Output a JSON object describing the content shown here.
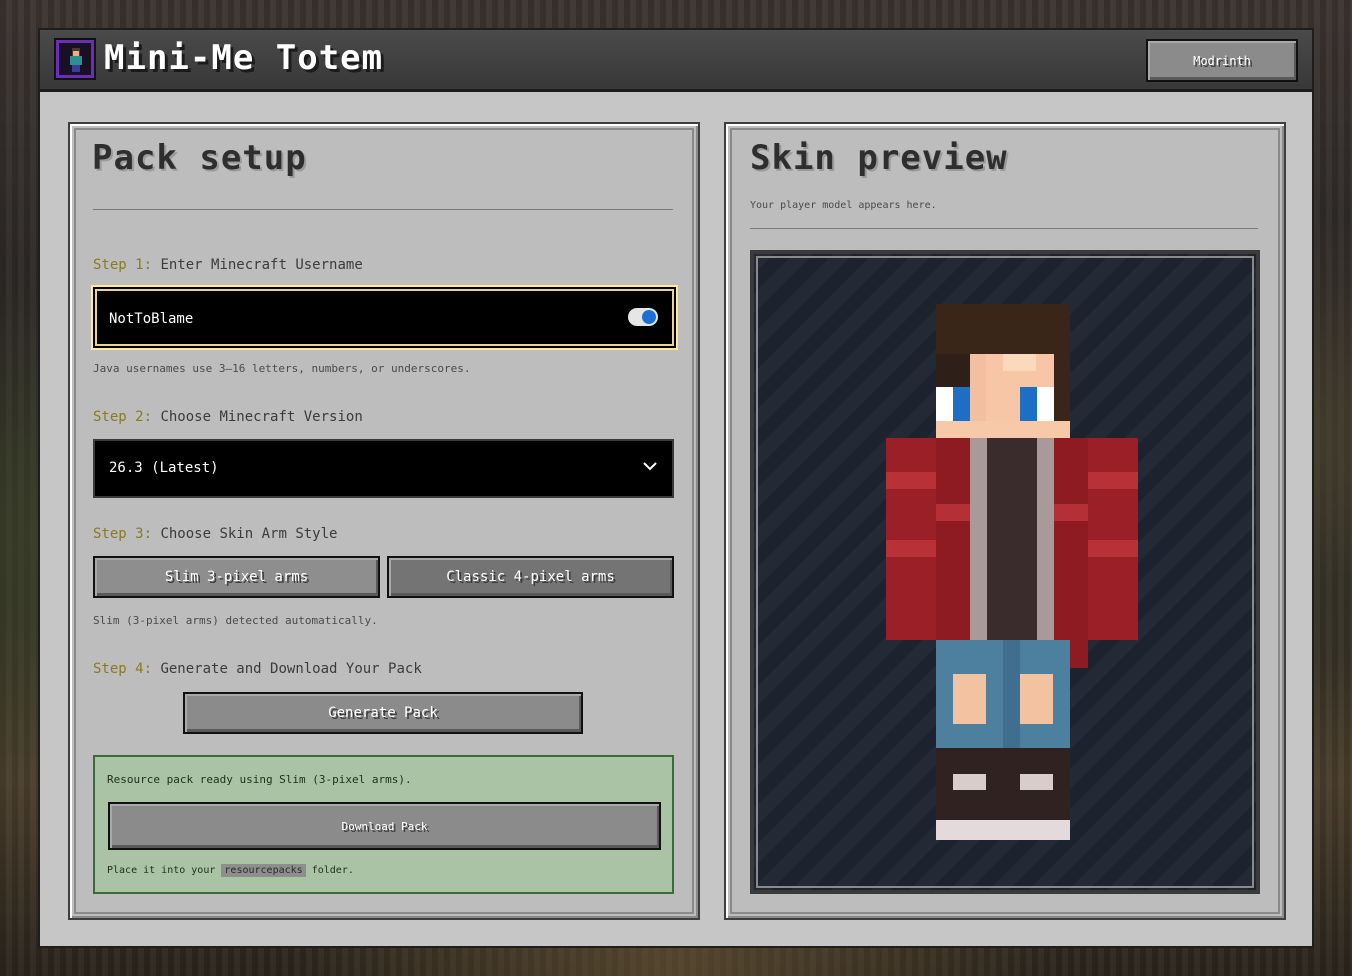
{
  "app": {
    "title": "Mini-Me Totem",
    "modrinth_label": "Modrinth"
  },
  "setup": {
    "title": "Pack setup",
    "step1": {
      "prefix": "Step 1:",
      "label": "Enter Minecraft Username"
    },
    "username_value": "NotToBlame",
    "username_hint": "Java usernames use 3–16 letters, numbers, or underscores.",
    "step2": {
      "prefix": "Step 2:",
      "label": "Choose Minecraft Version"
    },
    "version_value": "26.3 (Latest)",
    "step3": {
      "prefix": "Step 3:",
      "label": "Choose Skin Arm Style"
    },
    "slim_label": "Slim 3-pixel arms",
    "classic_label": "Classic 4-pixel arms",
    "arm_hint": "Slim (3-pixel arms) detected automatically.",
    "step4": {
      "prefix": "Step 4:",
      "label": "Generate and Download Your Pack"
    },
    "generate_label": "Generate Pack",
    "ready_text": "Resource pack ready using Slim (3-pixel arms).",
    "download_label": "Download Pack",
    "place_prefix": "Place it into your",
    "place_code": "resourcepacks",
    "place_suffix": "folder."
  },
  "preview": {
    "title": "Skin preview",
    "subtitle": "Your player model appears here."
  },
  "icons": {
    "logo": "totem-logo-icon",
    "password_manager": "password-manager-icon",
    "dropdown": "chevron-down-icon"
  },
  "colors": {
    "accent_yellow": "#8a7a20",
    "focus_border": "#ffe99c",
    "ready_bg": "#a9c3a4"
  }
}
